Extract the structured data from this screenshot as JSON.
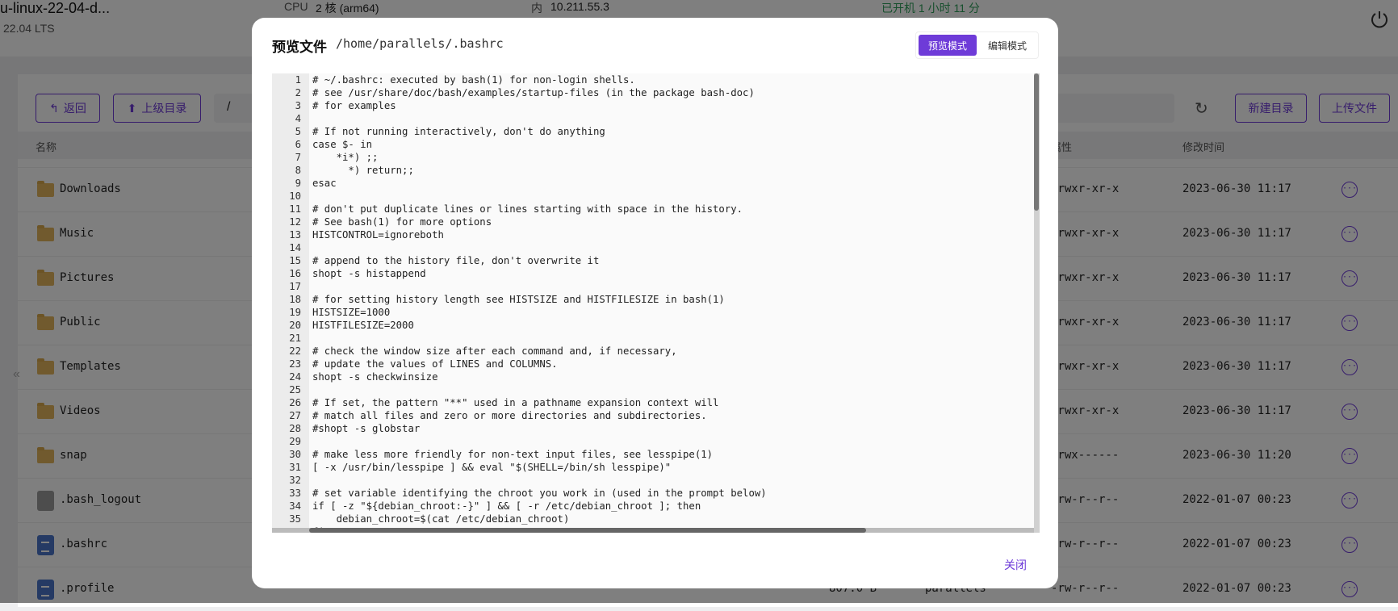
{
  "header": {
    "vm_name": "u-linux-22-04-d...",
    "os_version": "22.04 LTS",
    "cpu_label": "CPU",
    "cpu_value": "2 核 (arm64)",
    "ip_label": "内",
    "ip_value": "10.211.55.3",
    "uptime": "已开机 1 小时 11 分",
    "uptime_color": "#2e9e5b",
    "power_icon": "power-icon"
  },
  "toolbar": {
    "back_label": "返回",
    "parent_label": "上级目录",
    "path": "/",
    "new_dir_label": "新建目录",
    "upload_label": "上传文件",
    "refresh_icon": "refresh-icon"
  },
  "table": {
    "columns": {
      "name": "名称",
      "attr": "属性",
      "mtime": "修改时间"
    },
    "rows": [
      {
        "name": "Downloads",
        "type": "folder",
        "perm": "drwxr-xr-x",
        "mtime": "2023-06-30 11:17"
      },
      {
        "name": "Music",
        "type": "folder",
        "perm": "drwxr-xr-x",
        "mtime": "2023-06-30 11:17"
      },
      {
        "name": "Pictures",
        "type": "folder",
        "perm": "drwxr-xr-x",
        "mtime": "2023-06-30 11:17"
      },
      {
        "name": "Public",
        "type": "folder",
        "perm": "drwxr-xr-x",
        "mtime": "2023-06-30 11:17"
      },
      {
        "name": "Templates",
        "type": "folder",
        "perm": "drwxr-xr-x",
        "mtime": "2023-06-30 11:17"
      },
      {
        "name": "Videos",
        "type": "folder",
        "perm": "drwxr-xr-x",
        "mtime": "2023-06-30 11:17"
      },
      {
        "name": "snap",
        "type": "folder",
        "perm": "drwx------",
        "mtime": "2023-06-30 11:20"
      },
      {
        "name": ".bash_logout",
        "type": "plain",
        "perm": "-rw-r--r--",
        "mtime": "2022-01-07 00:23"
      },
      {
        "name": ".bashrc",
        "type": "doc",
        "perm": "-rw-r--r--",
        "mtime": "2022-01-07 00:23"
      },
      {
        "name": ".profile",
        "type": "doc",
        "size": "807.0 B",
        "owner": "parallels",
        "perm": "-rw-r--r--",
        "mtime": "2022-01-07 00:23"
      }
    ]
  },
  "dialog": {
    "title": "预览文件",
    "path": "/home/parallels/.bashrc",
    "mode_preview": "预览模式",
    "mode_edit": "编辑模式",
    "active_mode": "preview",
    "accent": "#6e3bd8",
    "close_label": "关闭",
    "code_lines": [
      "# ~/.bashrc: executed by bash(1) for non-login shells.",
      "# see /usr/share/doc/bash/examples/startup-files (in the package bash-doc)",
      "# for examples",
      "",
      "# If not running interactively, don't do anything",
      "case $- in",
      "    *i*) ;;",
      "      *) return;;",
      "esac",
      "",
      "# don't put duplicate lines or lines starting with space in the history.",
      "# See bash(1) for more options",
      "HISTCONTROL=ignoreboth",
      "",
      "# append to the history file, don't overwrite it",
      "shopt -s histappend",
      "",
      "# for setting history length see HISTSIZE and HISTFILESIZE in bash(1)",
      "HISTSIZE=1000",
      "HISTFILESIZE=2000",
      "",
      "# check the window size after each command and, if necessary,",
      "# update the values of LINES and COLUMNS.",
      "shopt -s checkwinsize",
      "",
      "# If set, the pattern \"**\" used in a pathname expansion context will",
      "# match all files and zero or more directories and subdirectories.",
      "#shopt -s globstar",
      "",
      "# make less more friendly for non-text input files, see lesspipe(1)",
      "[ -x /usr/bin/lesspipe ] && eval \"$(SHELL=/bin/sh lesspipe)\"",
      "",
      "# set variable identifying the chroot you work in (used in the prompt below)",
      "if [ -z \"${debian_chroot:-}\" ] && [ -r /etc/debian_chroot ]; then",
      "    debian_chroot=$(cat /etc/debian_chroot)",
      "fi"
    ]
  }
}
